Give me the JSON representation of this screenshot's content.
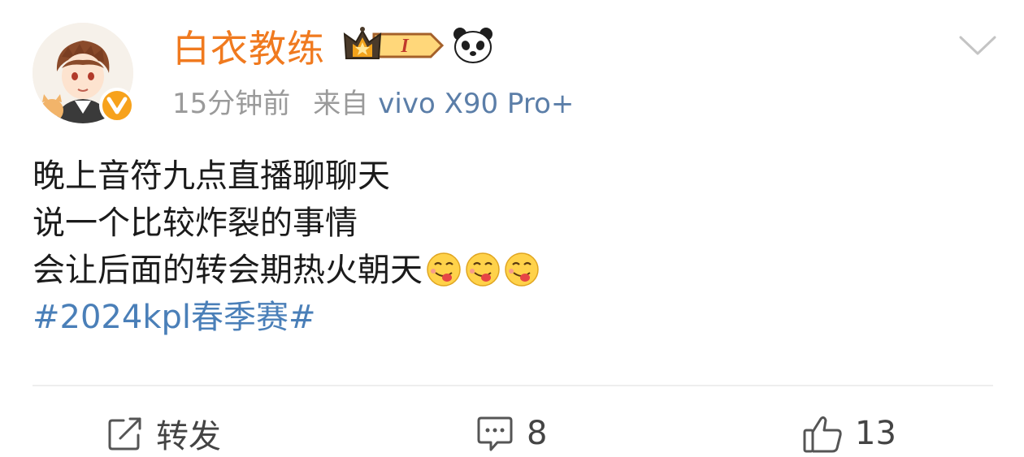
{
  "post": {
    "author": "白衣教练",
    "time": "15分钟前",
    "source_prefix": "来自",
    "device": "vivo X90 Pro+",
    "badge_text": "I",
    "lines": [
      "晚上音符九点直播聊聊天",
      "说一个比较炸裂的事情",
      "会让后面的转会期热火朝天"
    ],
    "emoji_count": 3,
    "hashtag": "#2024kpl春季赛#"
  },
  "actions": {
    "repost_label": "转发",
    "comment_count": "8",
    "like_count": "13"
  },
  "icons": {
    "avatar": "cartoon-avatar",
    "verified": "verified-v-icon",
    "crown": "crown-badge-icon",
    "panda": "panda-icon",
    "menu": "chevron-down-icon",
    "repost": "repost-icon",
    "comment": "comment-icon",
    "like": "thumbs-up-icon",
    "emoji": "yum-emoji-icon"
  },
  "colors": {
    "username": "#f07a1f",
    "link": "#5b7ea8",
    "hashtag": "#4a7fb8",
    "meta": "#9a9a9a",
    "verified": "#f7a21c"
  }
}
